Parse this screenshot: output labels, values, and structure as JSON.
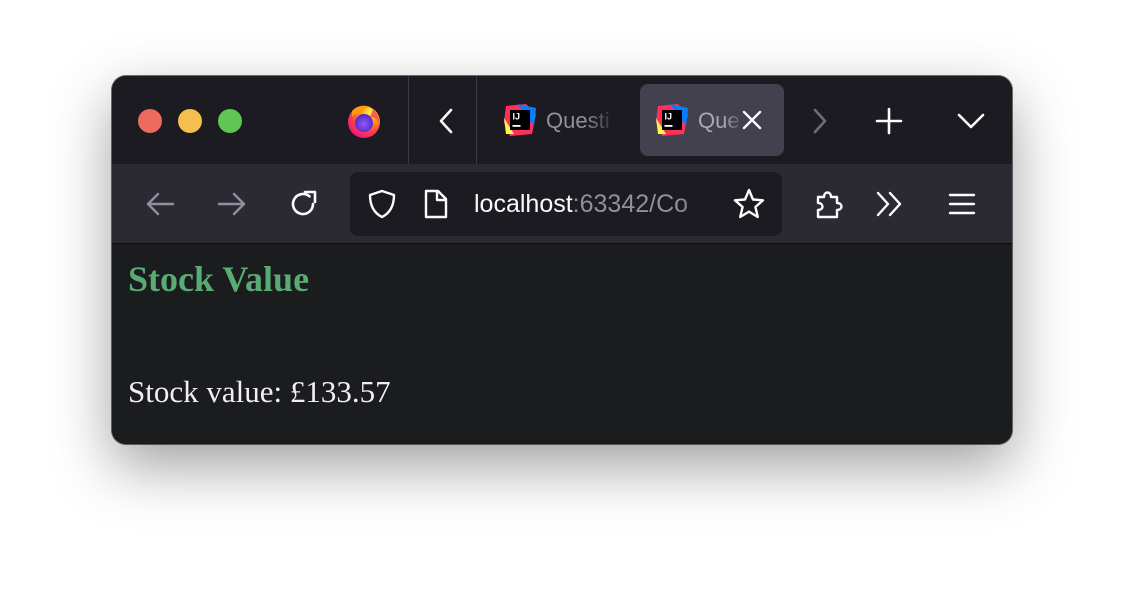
{
  "browser": {
    "tabs": [
      {
        "title": "Questi",
        "favicon": "intellij-icon",
        "active": false
      },
      {
        "title": "Que",
        "favicon": "intellij-icon",
        "active": true
      }
    ],
    "address_bar": {
      "host": "localhost",
      "rest": ":63342/Co"
    },
    "icons": {
      "window_controls": [
        "close",
        "minimize",
        "maximize"
      ],
      "toolbar": [
        "back-arrow-icon",
        "forward-arrow-icon",
        "reload-icon",
        "shield-icon",
        "page-icon",
        "star-icon",
        "extensions-icon",
        "overflow-chevrons-icon",
        "hamburger-menu-icon"
      ],
      "tabbar": [
        "firefox-logo-icon",
        "chevron-left-icon",
        "chevron-right-icon",
        "plus-icon",
        "chevron-down-icon"
      ]
    },
    "colors": {
      "traffic_close": "#ec6a5e",
      "traffic_minimize": "#f4bf4f",
      "traffic_maximize": "#61c554",
      "active_tab": "#42414d",
      "toolbar": "#2b2a33",
      "page_background": "#1b1c1e"
    }
  },
  "page": {
    "heading": "Stock Value",
    "stock_text": "Stock value: £133.57",
    "colors": {
      "heading": "#57ab73",
      "text": "#f0f0f2"
    }
  }
}
